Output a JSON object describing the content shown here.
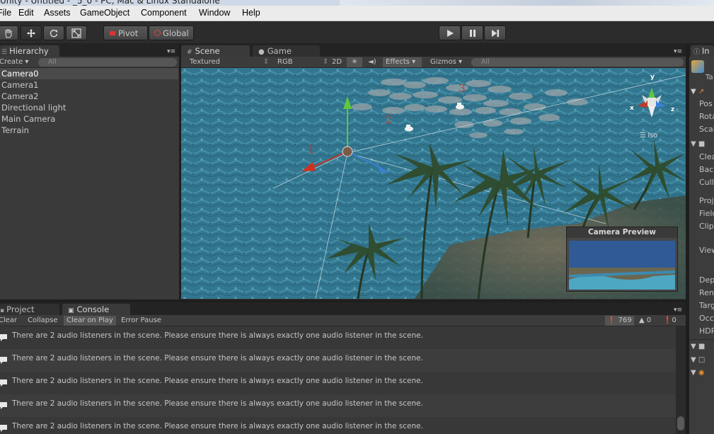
{
  "window": {
    "title": "Unity - Untitled - _5_0 - PC, Mac & Linux Standalone"
  },
  "menu": [
    "File",
    "Edit",
    "Assets",
    "GameObject",
    "Component",
    "Window",
    "Help"
  ],
  "toolbar": {
    "pivot": "Pivot",
    "global": "Global"
  },
  "hierarchy": {
    "tab": "Hierarchy",
    "create": "Create",
    "search_placeholder": "All",
    "items": [
      "Camera0",
      "Camera1",
      "Camera2",
      "Directional light",
      "Main Camera",
      "Terrain"
    ],
    "selected": "Camera0"
  },
  "scene_view": {
    "tab_scene": "Scene",
    "tab_game": "Game",
    "shading": "Textured",
    "render_mode": "RGB",
    "mode_2d": "2D",
    "effects": "Effects",
    "gizmos": "Gizmos",
    "search_placeholder": "All",
    "labels": [
      "1",
      "2",
      "3"
    ],
    "gizmo_axes": {
      "y": "y",
      "x": "x",
      "z": "z",
      "proj": "Iso"
    },
    "camera_preview_title": "Camera Preview"
  },
  "bottom": {
    "tab_project": "Project",
    "tab_console": "Console",
    "buttons": [
      "Clear",
      "Collapse",
      "Clear on Play",
      "Error Pause"
    ],
    "counts": {
      "info": "769",
      "warnings": "0",
      "errors": "0"
    },
    "messages": [
      "There are 2 audio listeners in the scene. Please ensure there is always exactly one audio listener in the scene.",
      "There are 2 audio listeners in the scene. Please ensure there is always exactly one audio listener in the scene.",
      "There are 2 audio listeners in the scene. Please ensure there is always exactly one audio listener in the scene.",
      "There are 2 audio listeners in the scene. Please ensure there is always exactly one audio listener in the scene.",
      "There are 2 audio listeners in the scene. Please ensure there is always exactly one audio listener in the scene."
    ]
  },
  "inspector": {
    "tab": "In",
    "tag": "Ta",
    "items": [
      "Pos",
      "Rota",
      "Scal",
      "Clea",
      "Back",
      "Culli",
      "Proj",
      "Field",
      "Clipp",
      "View",
      "Dep",
      "Rend",
      "Targ",
      "Occl",
      "HDR"
    ]
  },
  "colors": {
    "accent_red": "#c0392b",
    "gizmo_green": "#5fc83c",
    "gizmo_blue": "#3a7fd6"
  }
}
